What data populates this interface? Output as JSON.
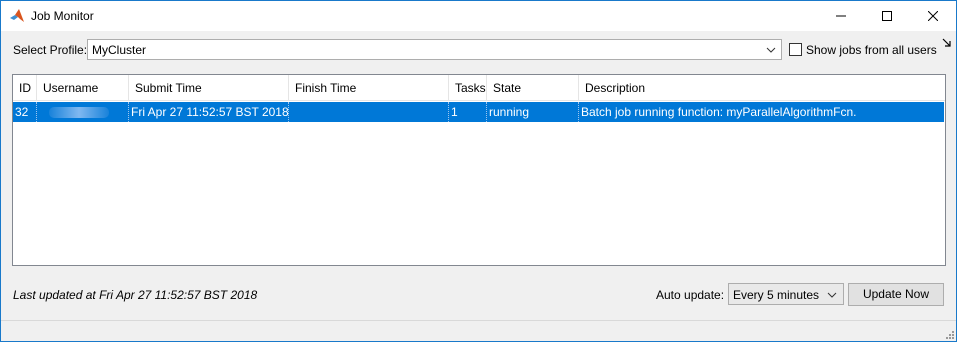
{
  "window": {
    "title": "Job Monitor"
  },
  "profile": {
    "label": "Select Profile:",
    "value": "MyCluster"
  },
  "show_all_users": {
    "label": "Show jobs from all users",
    "checked": false
  },
  "table": {
    "columns": [
      "ID",
      "Username",
      "Submit Time",
      "Finish Time",
      "Tasks",
      "State",
      "Description"
    ],
    "rows": [
      {
        "id": "32",
        "username": "",
        "submit_time": "Fri Apr 27 11:52:57 BST 2018",
        "finish_time": "",
        "tasks": "1",
        "state": "running",
        "description": "Batch job running function: myParallelAlgorithmFcn.",
        "selected": true
      }
    ]
  },
  "status": {
    "last_updated": "Last updated at Fri Apr 27 11:52:57 BST 2018"
  },
  "auto_update": {
    "label": "Auto update:",
    "value": "Every 5 minutes"
  },
  "buttons": {
    "update_now": "Update Now"
  },
  "colors": {
    "selection": "#0078d7",
    "accent_border": "#1979ca"
  }
}
